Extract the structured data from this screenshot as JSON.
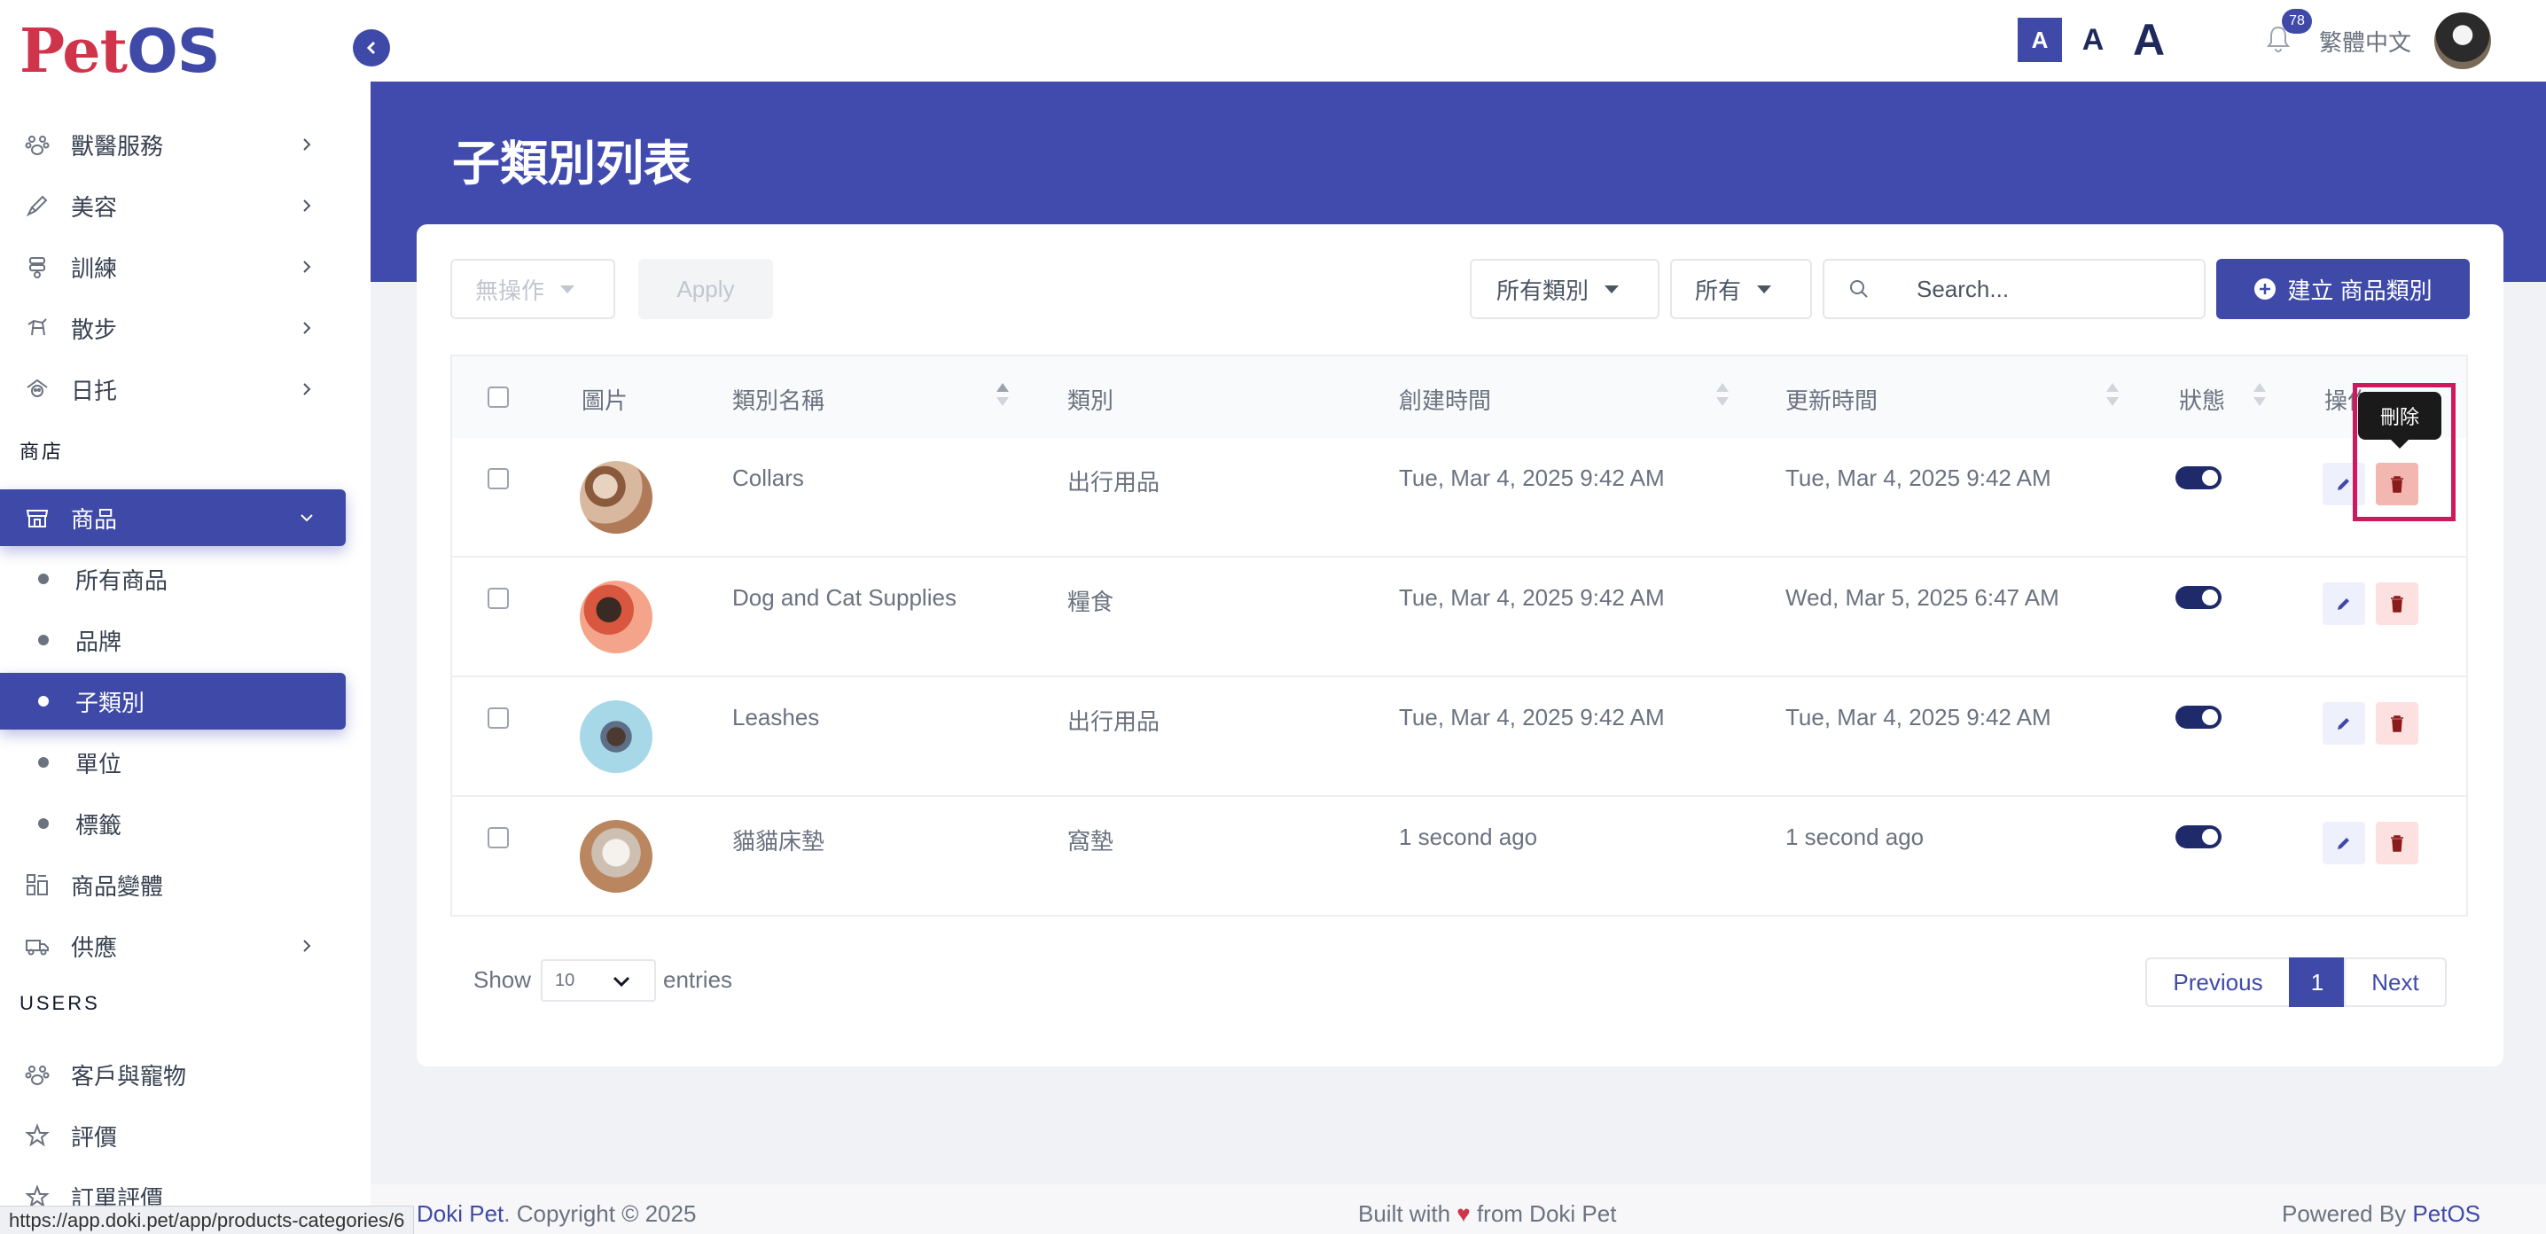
{
  "brand": {
    "logo_pet": "Pet",
    "logo_os": "OS"
  },
  "sidebar": {
    "groups": [
      {
        "label": "獸醫服務",
        "icon": "paw-icon"
      },
      {
        "label": "美容",
        "icon": "brush-icon"
      },
      {
        "label": "訓練",
        "icon": "collar-icon"
      },
      {
        "label": "散步",
        "icon": "walk-dog-icon"
      },
      {
        "label": "日托",
        "icon": "daycare-icon"
      }
    ],
    "shop_section": "商店",
    "products": {
      "label": "商品",
      "icon": "store-icon"
    },
    "product_subitems": [
      {
        "label": "所有商品"
      },
      {
        "label": "品牌"
      },
      {
        "label": "子類別"
      },
      {
        "label": "單位"
      },
      {
        "label": "標籤"
      }
    ],
    "variants": {
      "label": "商品變體",
      "icon": "variants-icon"
    },
    "supply": {
      "label": "供應",
      "icon": "truck-icon"
    },
    "users_section": "USERS",
    "customers": {
      "label": "客戶與寵物",
      "icon": "paw-outline-icon"
    },
    "reviews": {
      "label": "評價",
      "icon": "star-icon"
    },
    "order_reviews": {
      "label": "訂單評價",
      "icon": "star-icon"
    }
  },
  "topbar": {
    "font_small": "A",
    "font_medium": "A",
    "font_large": "A",
    "notification_count": "78",
    "language": "繁體中文"
  },
  "page": {
    "title": "子類別列表"
  },
  "toolbar": {
    "bulk_action": "無操作",
    "apply": "Apply",
    "category_filter": "所有類別",
    "status_filter": "所有",
    "search_placeholder": "Search...",
    "create": "建立 商品類別"
  },
  "table": {
    "headers": {
      "image": "圖片",
      "name": "類別名稱",
      "category": "類別",
      "created": "創建時間",
      "updated": "更新時間",
      "status": "狀態",
      "actions": "操作"
    },
    "rows": [
      {
        "name": "Collars",
        "category": "出行用品",
        "created": "Tue, Mar 4, 2025 9:42 AM",
        "updated": "Tue, Mar 4, 2025 9:42 AM",
        "active": true
      },
      {
        "name": "Dog and Cat Supplies",
        "category": "糧食",
        "created": "Tue, Mar 4, 2025 9:42 AM",
        "updated": "Wed, Mar 5, 2025 6:47 AM",
        "active": true
      },
      {
        "name": "Leashes",
        "category": "出行用品",
        "created": "Tue, Mar 4, 2025 9:42 AM",
        "updated": "Tue, Mar 4, 2025 9:42 AM",
        "active": true
      },
      {
        "name": "貓貓床墊",
        "category": "窩墊",
        "created": "1 second ago",
        "updated": "1 second ago",
        "active": true
      }
    ],
    "tooltip": "刪除"
  },
  "pagination": {
    "show": "Show",
    "page_size": "10",
    "entries": "entries",
    "previous": "Previous",
    "current": "1",
    "next": "Next"
  },
  "footer": {
    "left_brand": "Doki Pet",
    "left_rest": ". Copyright © 2025",
    "mid_a": "Built with",
    "mid_heart": "♥",
    "mid_b": "from Doki Pet",
    "right_a": "Powered By",
    "right_brand": "PetOS"
  },
  "status_url": "https://app.doki.pet/app/products-categories/6",
  "colors": {
    "primary": "#3f4aa8",
    "banner": "#414bae",
    "danger_bg": "#fde1e1",
    "highlight": "#d0185e"
  }
}
